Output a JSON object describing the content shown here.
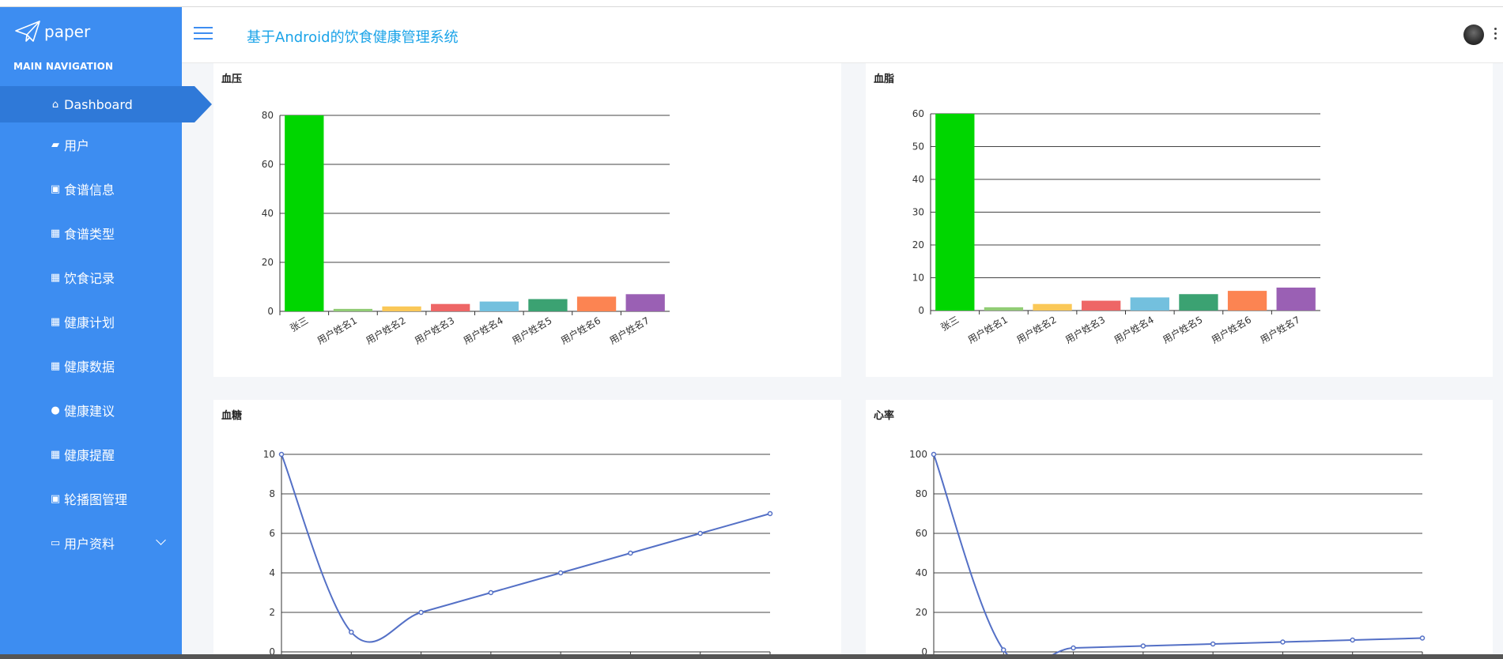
{
  "app": {
    "logo_text": "paper",
    "title": "基于Android的饮食健康管理系统"
  },
  "sidebar": {
    "header": "MAIN NAVIGATION",
    "items": [
      {
        "label": "Dashboard",
        "icon": "home-icon",
        "glyph": "⌂"
      },
      {
        "label": "用户",
        "icon": "user-card-icon",
        "glyph": "▰"
      },
      {
        "label": "食谱信息",
        "icon": "clipboard-icon",
        "glyph": "▣"
      },
      {
        "label": "食谱类型",
        "icon": "grid-icon",
        "glyph": "▦"
      },
      {
        "label": "饮食记录",
        "icon": "grid-icon",
        "glyph": "▦"
      },
      {
        "label": "健康计划",
        "icon": "grid-icon",
        "glyph": "▦"
      },
      {
        "label": "健康数据",
        "icon": "grid-icon",
        "glyph": "▦"
      },
      {
        "label": "健康建议",
        "icon": "person-icon",
        "glyph": "●"
      },
      {
        "label": "健康提醒",
        "icon": "grid-icon",
        "glyph": "▦"
      },
      {
        "label": "轮播图管理",
        "icon": "clipboard-icon",
        "glyph": "▣"
      },
      {
        "label": "用户资料",
        "icon": "calendar-icon",
        "glyph": "▭"
      }
    ]
  },
  "chart_data": [
    {
      "type": "bar",
      "title": "血压",
      "categories": [
        "张三",
        "用户姓名1",
        "用户姓名2",
        "用户姓名3",
        "用户姓名4",
        "用户姓名5",
        "用户姓名6",
        "用户姓名7"
      ],
      "values": [
        80,
        1,
        2,
        3,
        4,
        5,
        6,
        7
      ],
      "ylim": [
        0,
        80
      ],
      "yticks": [
        0,
        20,
        40,
        60,
        80
      ],
      "colors": [
        "#00d600",
        "#91cc75",
        "#fac858",
        "#ee6666",
        "#73c0de",
        "#3ba272",
        "#fc8452",
        "#9a60b4"
      ]
    },
    {
      "type": "bar",
      "title": "血脂",
      "categories": [
        "张三",
        "用户姓名1",
        "用户姓名2",
        "用户姓名3",
        "用户姓名4",
        "用户姓名5",
        "用户姓名6",
        "用户姓名7"
      ],
      "values": [
        60,
        1,
        2,
        3,
        4,
        5,
        6,
        7
      ],
      "ylim": [
        0,
        60
      ],
      "yticks": [
        0,
        10,
        20,
        30,
        40,
        50,
        60
      ],
      "colors": [
        "#00d600",
        "#91cc75",
        "#fac858",
        "#ee6666",
        "#73c0de",
        "#3ba272",
        "#fc8452",
        "#9a60b4"
      ]
    },
    {
      "type": "line",
      "title": "血糖",
      "values": [
        10,
        1,
        2,
        3,
        4,
        5,
        6,
        7
      ],
      "ylim": [
        0,
        10
      ],
      "yticks": [
        0,
        2,
        4,
        6,
        8,
        10
      ],
      "color": "#5470c6"
    },
    {
      "type": "line",
      "title": "心率",
      "values": [
        100,
        1,
        2,
        3,
        4,
        5,
        6,
        7
      ],
      "ylim": [
        0,
        100
      ],
      "yticks": [
        0,
        20,
        40,
        60,
        80,
        100
      ],
      "color": "#5470c6"
    }
  ]
}
